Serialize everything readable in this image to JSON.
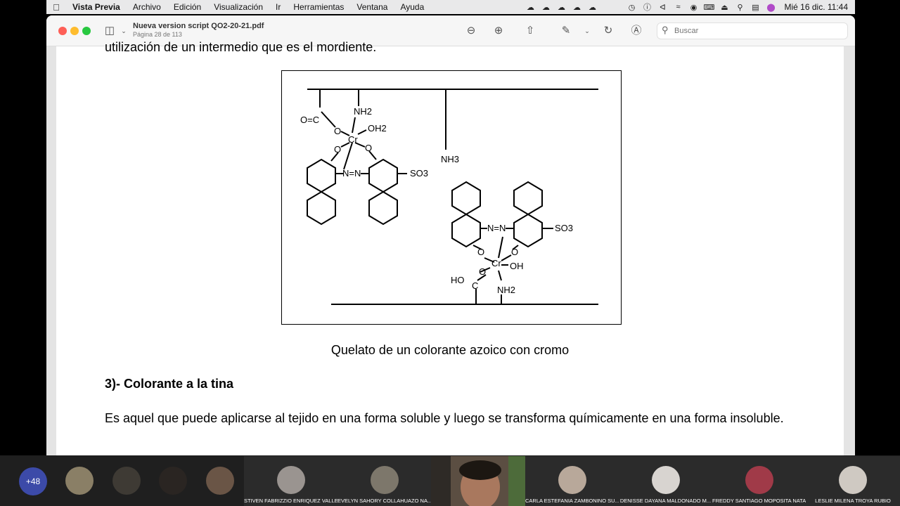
{
  "menubar": {
    "app": "Vista Previa",
    "items": [
      "Archivo",
      "Edición",
      "Visualización",
      "Ir",
      "Herramientas",
      "Ventana",
      "Ayuda"
    ],
    "clock": "Mié 16 dic.  11:44"
  },
  "window": {
    "filename": "Nueva version script QO2-20-21.pdf",
    "page_info": "Página 28 de 113",
    "search_placeholder": "Buscar"
  },
  "document": {
    "cut_line": "utilización de un intermedio que es el mordiente.",
    "caption": "Quelato de un colorante azoico con cromo",
    "heading": "3)- Colorante a la tina",
    "paragraph": "Es aquel que puede aplicarse al tejido en una forma soluble y luego se transforma químicamente en una forma insoluble."
  },
  "figure_labels": {
    "o_c": "O=C",
    "nh2_top": "NH2",
    "oh2": "OH2",
    "cr": "Cr",
    "o": "O",
    "n_n": "N=N",
    "so3": "SO3",
    "nh3": "NH3",
    "oh": "OH",
    "ho": "HO",
    "nh2_bottom": "NH2",
    "c": "C"
  },
  "participants": {
    "more_count": "+48",
    "tiles": [
      {
        "name": "STIVEN FABRIZZIO ENRIQUEZ VALLE"
      },
      {
        "name": "EVELYN SAHORY COLLAHUAZO NA..."
      },
      {
        "name": "CARLA ESTEFANIA ZAMBONINO SU..."
      },
      {
        "name": "DENISSE DAYANA MALDONADO M..."
      },
      {
        "name": "FREDDY SANTIAGO MOPOSITA NATA"
      },
      {
        "name": "LESLIE MILENA TROYA RUBIO"
      }
    ]
  },
  "colors": {
    "menubar_bg": "#e9e9ea",
    "more_badge": "#3c4aa8",
    "close": "#fe5f57",
    "minimize": "#febc2e",
    "zoom": "#28c840"
  }
}
